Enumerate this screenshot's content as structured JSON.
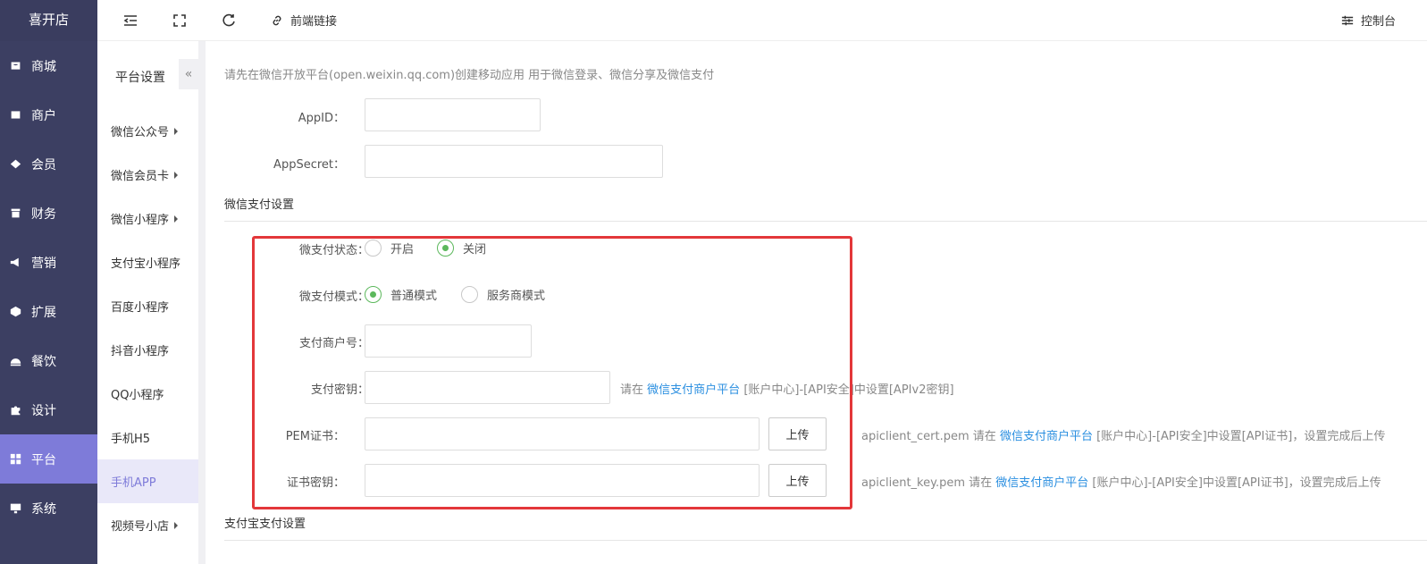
{
  "app": {
    "brand": "喜开店"
  },
  "sidebar": {
    "items": [
      {
        "label": "商城",
        "icon": "shop-icon"
      },
      {
        "label": "商户",
        "icon": "merchant-icon"
      },
      {
        "label": "会员",
        "icon": "member-icon"
      },
      {
        "label": "财务",
        "icon": "finance-icon"
      },
      {
        "label": "营销",
        "icon": "megaphone-icon"
      },
      {
        "label": "扩展",
        "icon": "cube-icon"
      },
      {
        "label": "餐饮",
        "icon": "dining-icon"
      },
      {
        "label": "设计",
        "icon": "puzzle-icon"
      },
      {
        "label": "平台",
        "icon": "grid-icon",
        "active": true
      },
      {
        "label": "系统",
        "icon": "monitor-icon"
      }
    ]
  },
  "subnav": {
    "title": "平台设置",
    "collapse": "«",
    "items": [
      {
        "label": "微信公众号",
        "has_caret": true
      },
      {
        "label": "微信会员卡",
        "has_caret": true
      },
      {
        "label": "微信小程序",
        "has_caret": true
      },
      {
        "label": "支付宝小程序"
      },
      {
        "label": "百度小程序"
      },
      {
        "label": "抖音小程序"
      },
      {
        "label": "QQ小程序"
      },
      {
        "label": "手机H5"
      },
      {
        "label": "手机APP",
        "active": true
      },
      {
        "label": "视频号小店",
        "has_caret": true
      }
    ]
  },
  "topbar": {
    "link_label": "前端链接",
    "console_label": "控制台"
  },
  "main": {
    "hint": "请先在微信开放平台(open.weixin.qq.com)创建移动应用 用于微信登录、微信分享及微信支付",
    "appid_label": "AppID：",
    "appsecret_label": "AppSecret：",
    "wxpay_section": "微信支付设置",
    "pay_status_label": "微支付状态：",
    "pay_status_options": [
      "开启",
      "关闭"
    ],
    "pay_status_selected": "关闭",
    "pay_mode_label": "微支付模式：",
    "pay_mode_options": [
      "普通模式",
      "服务商模式"
    ],
    "pay_mode_selected": "普通模式",
    "merchant_no_label": "支付商户号：",
    "pay_key_label": "支付密钥：",
    "pay_key_tip_prefix": "请在",
    "pay_key_tip_link": "微信支付商户平台",
    "pay_key_tip_suffix": "[账户中心]-[API安全]中设置[APIv2密钥]",
    "pem_label": "PEM证书：",
    "pem_upload": "上传",
    "pem_tip_prefix": "apiclient_cert.pem 请在",
    "pem_tip_link": "微信支付商户平台",
    "pem_tip_suffix": "[账户中心]-[API安全]中设置[API证书]，设置完成后上传",
    "cert_key_label": "证书密钥：",
    "cert_key_upload": "上传",
    "cert_key_tip_prefix": "apiclient_key.pem 请在",
    "cert_key_tip_link": "微信支付商户平台",
    "cert_key_tip_suffix": "[账户中心]-[API安全]中设置[API证书]，设置完成后上传",
    "alipay_section": "支付宝支付设置"
  },
  "colors": {
    "sidebar_bg": "#3c3f62",
    "accent": "#7e7bd9",
    "radio_green": "#5cb85c",
    "link_blue": "#2b8fe0",
    "highlight_red": "#e3373a"
  }
}
